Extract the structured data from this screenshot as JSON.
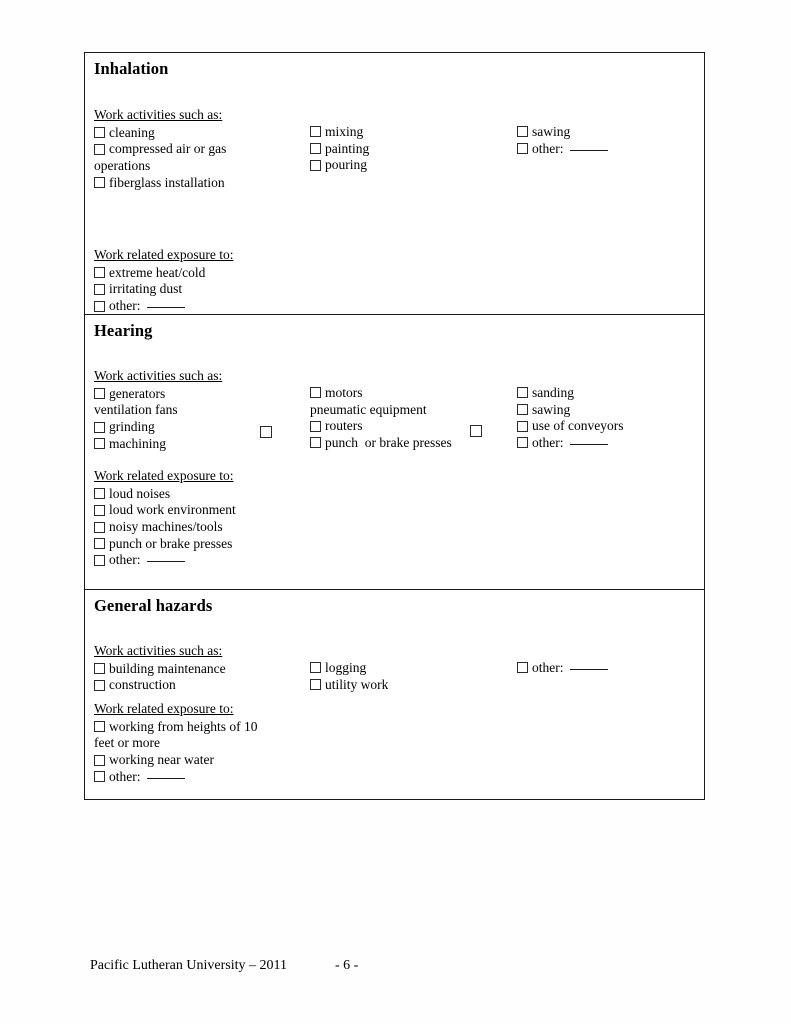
{
  "document": {
    "sections": [
      {
        "title": "Inhalation",
        "activities_label": "Work activities such as:",
        "exposure_label": "Work related exposure to:",
        "activities_col_a": [
          {
            "text": "cleaning",
            "checkbox": true
          },
          {
            "text": "compressed air or gas",
            "checkbox": true
          },
          {
            "text": "operations",
            "checkbox": false
          },
          {
            "text": "fiberglass installation",
            "checkbox": true
          }
        ],
        "activities_col_b": [
          {
            "text": "mixing",
            "checkbox": true
          },
          {
            "text": "painting",
            "checkbox": true
          },
          {
            "text": "pouring",
            "checkbox": true
          }
        ],
        "activities_col_c": [
          {
            "text": "sawing",
            "checkbox": true
          },
          {
            "text": "other:",
            "checkbox": true,
            "blank": true
          }
        ],
        "exposure_col_a": [
          {
            "text": "extreme heat/cold",
            "checkbox": true
          },
          {
            "text": "irritating dust",
            "checkbox": true
          },
          {
            "text": "other:",
            "checkbox": true,
            "blank": true
          }
        ]
      },
      {
        "title": "Hearing",
        "activities_label": "Work activities such as:",
        "exposure_label": "Work related exposure to:",
        "activities_col_a": [
          {
            "text": "generators",
            "checkbox": true
          },
          {
            "text": "ventilation fans",
            "checkbox": false
          },
          {
            "text": "grinding",
            "checkbox": true
          },
          {
            "text": "machining",
            "checkbox": true
          }
        ],
        "activities_col_b": [
          {
            "text": "motors",
            "checkbox": true
          },
          {
            "text": "pneumatic equipment",
            "checkbox": false
          },
          {
            "text": "routers",
            "checkbox": true
          },
          {
            "text": "punch  or brake presses",
            "checkbox": true
          }
        ],
        "activities_col_c": [
          {
            "text": "sanding",
            "checkbox": true
          },
          {
            "text": "sawing",
            "checkbox": true
          },
          {
            "text": "use of conveyors",
            "checkbox": true
          },
          {
            "text": "other:",
            "checkbox": true,
            "blank": true
          }
        ],
        "loose_checkboxes": 2,
        "exposure_col_a": [
          {
            "text": "loud noises",
            "checkbox": true
          },
          {
            "text": "loud work environment",
            "checkbox": true
          },
          {
            "text": "noisy machines/tools",
            "checkbox": true
          },
          {
            "text": "punch or brake presses",
            "checkbox": true
          },
          {
            "text": "other:",
            "checkbox": true,
            "blank": true
          }
        ]
      },
      {
        "title": "General hazards",
        "activities_label": "Work activities such as:",
        "exposure_label": "Work related exposure to:",
        "activities_col_a": [
          {
            "text": "building maintenance",
            "checkbox": true
          },
          {
            "text": "construction",
            "checkbox": true
          }
        ],
        "activities_col_b": [
          {
            "text": "logging",
            "checkbox": true
          },
          {
            "text": "utility work",
            "checkbox": true
          }
        ],
        "activities_col_c": [
          {
            "text": "other:",
            "checkbox": true,
            "blank": true
          }
        ],
        "exposure_col_a": [
          {
            "text": "working from heights of 10",
            "checkbox": true
          },
          {
            "text": "feet or more",
            "checkbox": false
          },
          {
            "text": "working near water",
            "checkbox": true
          },
          {
            "text": "other:",
            "checkbox": true,
            "blank": true
          }
        ]
      }
    ]
  },
  "footer": {
    "organization": "Pacific Lutheran University – 2011",
    "page_number": "- 6 -"
  }
}
